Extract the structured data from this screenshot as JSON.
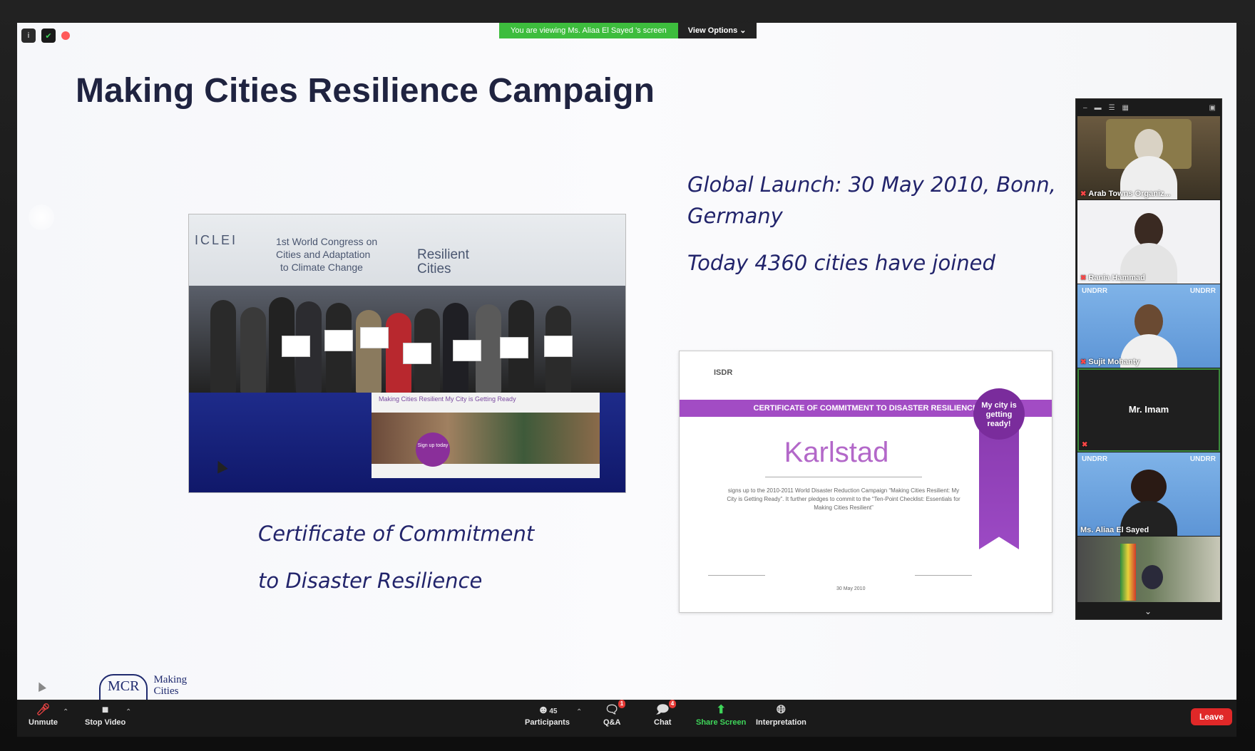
{
  "app": {
    "share_banner": "You are viewing Ms. Aliaa El Sayed 's screen",
    "view_options": "View Options ⌄"
  },
  "slide": {
    "title": "Making Cities Resilience Campaign",
    "launch_line1": "Global Launch: 30 May 2010, Bonn,",
    "launch_line2": "Germany",
    "joined": "Today 4360 cities have joined",
    "caption_line1": "Certificate of Commitment",
    "caption_line2": "to Disaster Resilience",
    "photo": {
      "banner_org": "ICLEI",
      "banner_congress_1": "1st World Congress on",
      "banner_congress_2": "Cities and Adaptation",
      "banner_congress_3": "to Climate Change",
      "banner_resilient_1": "Resilient",
      "banner_resilient_2": "Cities",
      "board_text": "Making Cities Resilient  My City is Getting Ready",
      "sticker": "Sign up today"
    },
    "certificate": {
      "logo": "ISDR",
      "bar": "CERTIFICATE OF COMMITMENT TO DISASTER RESILIENCE",
      "city": "Karlstad",
      "body": "signs up to the 2010-2011 World Disaster Reduction Campaign “Making Cities Resilient: My City is Getting Ready”. It further pledges to commit to the “Ten-Point Checklist: Essentials for Making Cities Resilient”",
      "seal": "My city is getting ready!",
      "date": "30 May 2010"
    },
    "mcr_logo": "MCR",
    "mcr_text_1": "Making",
    "mcr_text_2": "Cities"
  },
  "gallery": {
    "participants": [
      {
        "name": "Arab Towns Organiz...",
        "muted": true
      },
      {
        "name": "Rania Hammad",
        "muted": true
      },
      {
        "name": "Sujit Mohanty",
        "muted": true
      },
      {
        "name": "Mr. Imam",
        "muted": true
      },
      {
        "name": "Ms. Aliaa El Sayed",
        "muted": false
      }
    ],
    "undrr_logo": "UNDRR"
  },
  "toolbar": {
    "unmute": "Unmute",
    "stop_video": "Stop Video",
    "participants": "Participants",
    "participants_count": "45",
    "qa": "Q&A",
    "qa_badge": "1",
    "chat": "Chat",
    "chat_badge": "4",
    "share_screen": "Share Screen",
    "interpretation": "Interpretation",
    "leave": "Leave"
  },
  "colors": {
    "title": "#1f2340",
    "italic_text": "#22246b",
    "banner_green": "#3dbd3d",
    "cert_purple": "#a24cc4",
    "leave_red": "#e02828"
  }
}
